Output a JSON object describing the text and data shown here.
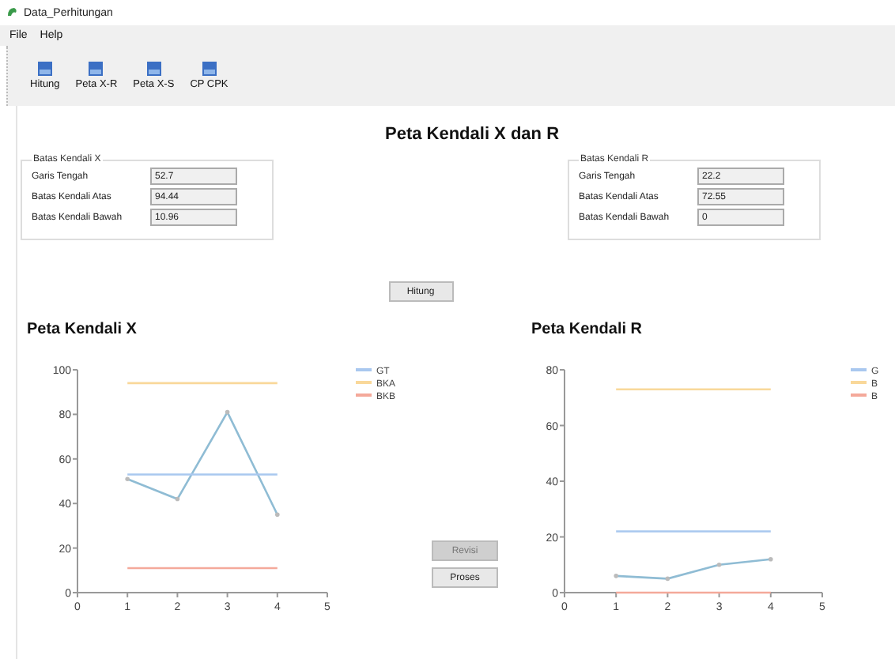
{
  "window": {
    "title": "Data_Perhitungan"
  },
  "menu": [
    "File",
    "Help"
  ],
  "toolbar": [
    "Hitung",
    "Peta X-R",
    "Peta X-S",
    "CP  CPK"
  ],
  "heading": "Peta Kendali X dan R",
  "groups": [
    {
      "title": "Batas Kendali X",
      "fields": [
        {
          "label": "Garis Tengah",
          "value": "52.7"
        },
        {
          "label": "Batas Kendali Atas",
          "value": "94.44"
        },
        {
          "label": "Batas Kendali Bawah",
          "value": "10.96"
        }
      ]
    },
    {
      "title": "Batas Kendali R",
      "fields": [
        {
          "label": "Garis Tengah",
          "value": "22.2"
        },
        {
          "label": "Batas Kendali Atas",
          "value": "72.55"
        },
        {
          "label": "Batas Kendali Bawah",
          "value": "0"
        }
      ]
    }
  ],
  "hitung_button": "Hitung",
  "side_buttons": [
    {
      "label": "Revisi",
      "disabled": true
    },
    {
      "label": "Proses",
      "disabled": false
    }
  ],
  "charts": [
    {
      "heading": "Peta Kendali X",
      "chart_data": {
        "type": "line",
        "legend": true,
        "x": [
          1,
          2,
          3,
          4
        ],
        "xlim": [
          0,
          5
        ],
        "ylim": [
          0,
          100
        ],
        "xticks": [
          0,
          1,
          2,
          3,
          4,
          5
        ],
        "yticks": [
          0,
          20,
          40,
          60,
          80,
          100
        ],
        "series": [
          {
            "color": "#8fbcd4",
            "values": [
              51,
              42,
              81,
              35
            ]
          },
          {
            "name": "GT",
            "color": "#a9c8ef",
            "values": [
              53,
              53,
              53,
              53
            ]
          },
          {
            "name": "BKA",
            "color": "#f9d89a",
            "values": [
              94,
              94,
              94,
              94
            ]
          },
          {
            "name": "BKB",
            "color": "#f4a99a",
            "values": [
              11,
              11,
              11,
              11
            ]
          }
        ]
      }
    },
    {
      "heading": "Peta Kendali R",
      "chart_data": {
        "type": "line",
        "legend": true,
        "x": [
          1,
          2,
          3,
          4
        ],
        "xlim": [
          0,
          5
        ],
        "ylim": [
          0,
          80
        ],
        "xticks": [
          0,
          1,
          2,
          3,
          4,
          5
        ],
        "yticks": [
          0,
          20,
          40,
          60,
          80
        ],
        "series": [
          {
            "color": "#8fbcd4",
            "values": [
              6,
              5,
              10,
              12
            ]
          },
          {
            "name": "G",
            "color": "#a9c8ef",
            "values": [
              22,
              22,
              22,
              22
            ]
          },
          {
            "name": "B",
            "color": "#f9d89a",
            "values": [
              73,
              73,
              73,
              73
            ]
          },
          {
            "name": "B",
            "color": "#f4a99a",
            "values": [
              0,
              0,
              0,
              0
            ]
          }
        ]
      }
    }
  ]
}
